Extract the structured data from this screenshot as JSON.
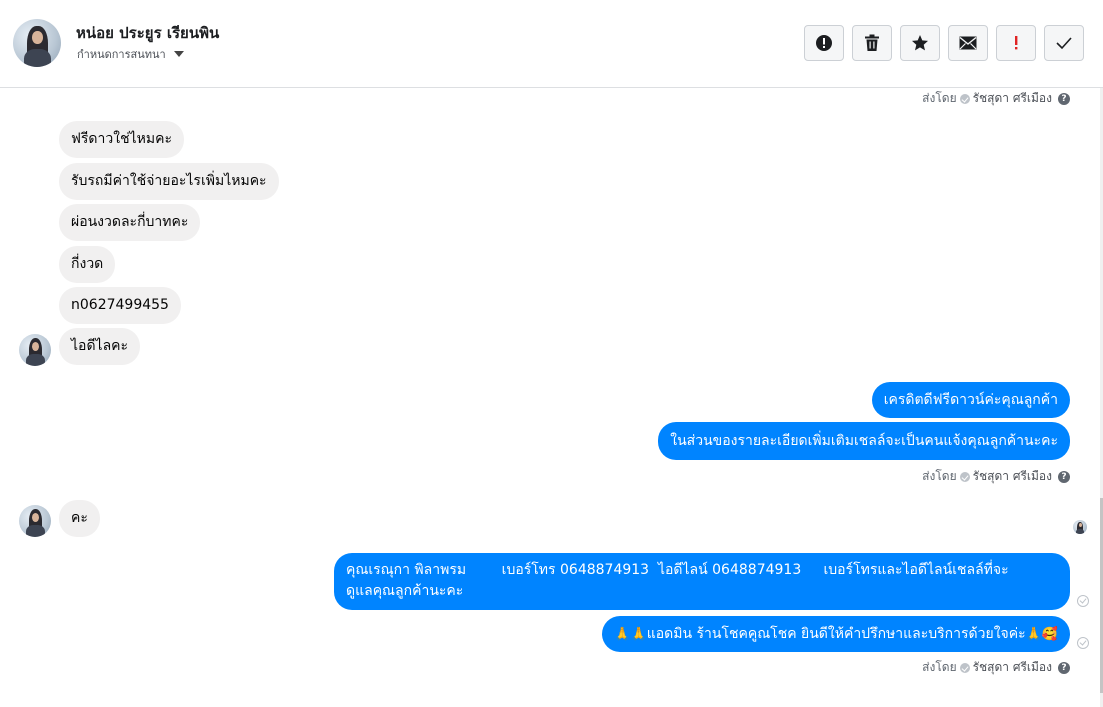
{
  "header": {
    "contact_name": "หน่อย ประยูร เรียนพิน",
    "conversation_settings": "กำหนดการสนทนา"
  },
  "toolbar": {
    "buttons": [
      {
        "name": "spam-button",
        "icon": "alert-circle-icon"
      },
      {
        "name": "delete-button",
        "icon": "trash-icon"
      },
      {
        "name": "star-button",
        "icon": "star-icon"
      },
      {
        "name": "mark-unread-button",
        "icon": "envelope-icon"
      },
      {
        "name": "follow-up-button",
        "icon": "exclamation-icon"
      },
      {
        "name": "mark-done-button",
        "icon": "check-icon"
      }
    ],
    "accent_color": "#e02424"
  },
  "sent_by": {
    "label": "ส่งโดย",
    "agent": "รัชสุดา ศรีเมือง"
  },
  "messages": {
    "in_1": "ฟรีดาวใช่ไหมคะ",
    "in_2": "รับรถมีค่าใช้จ่ายอะไรเพิ่มไหมคะ",
    "in_3": "ผ่อนงวดละกี่บาทคะ",
    "in_4": "กี่งวด",
    "in_5": "n0627499455",
    "in_6": "ไอดีไลคะ",
    "out_1": "เครดิตดีฟรีดาวน์ค่ะคุณลูกค้า",
    "out_2": "ในส่วนของรายละเอียดเพิ่มเติมเชลล์จะเป็นคนแจ้งคุณลูกค้านะคะ",
    "in_7": "คะ",
    "out_3_line1": "คุณเรณุกา พิลาพรม        เบอร์โทร 0648874913  ไอดีไลน์ 0648874913     เบอร์โทรและไอดีไลน์เชลล์ที่จะ",
    "out_3_line2": "ดูแลคุณลูกค้านะคะ",
    "out_4_emoji_lead": "🙏🙏",
    "out_4_text": "แอดมิน ร้านโชคคูณโชค ยินดีให้คำปรึกษาและบริการด้วยใจค่ะ",
    "out_4_emoji_tail": "🙏🥰"
  },
  "colors": {
    "outgoing_bubble": "#0084ff",
    "incoming_bubble": "#f1f0f0"
  }
}
